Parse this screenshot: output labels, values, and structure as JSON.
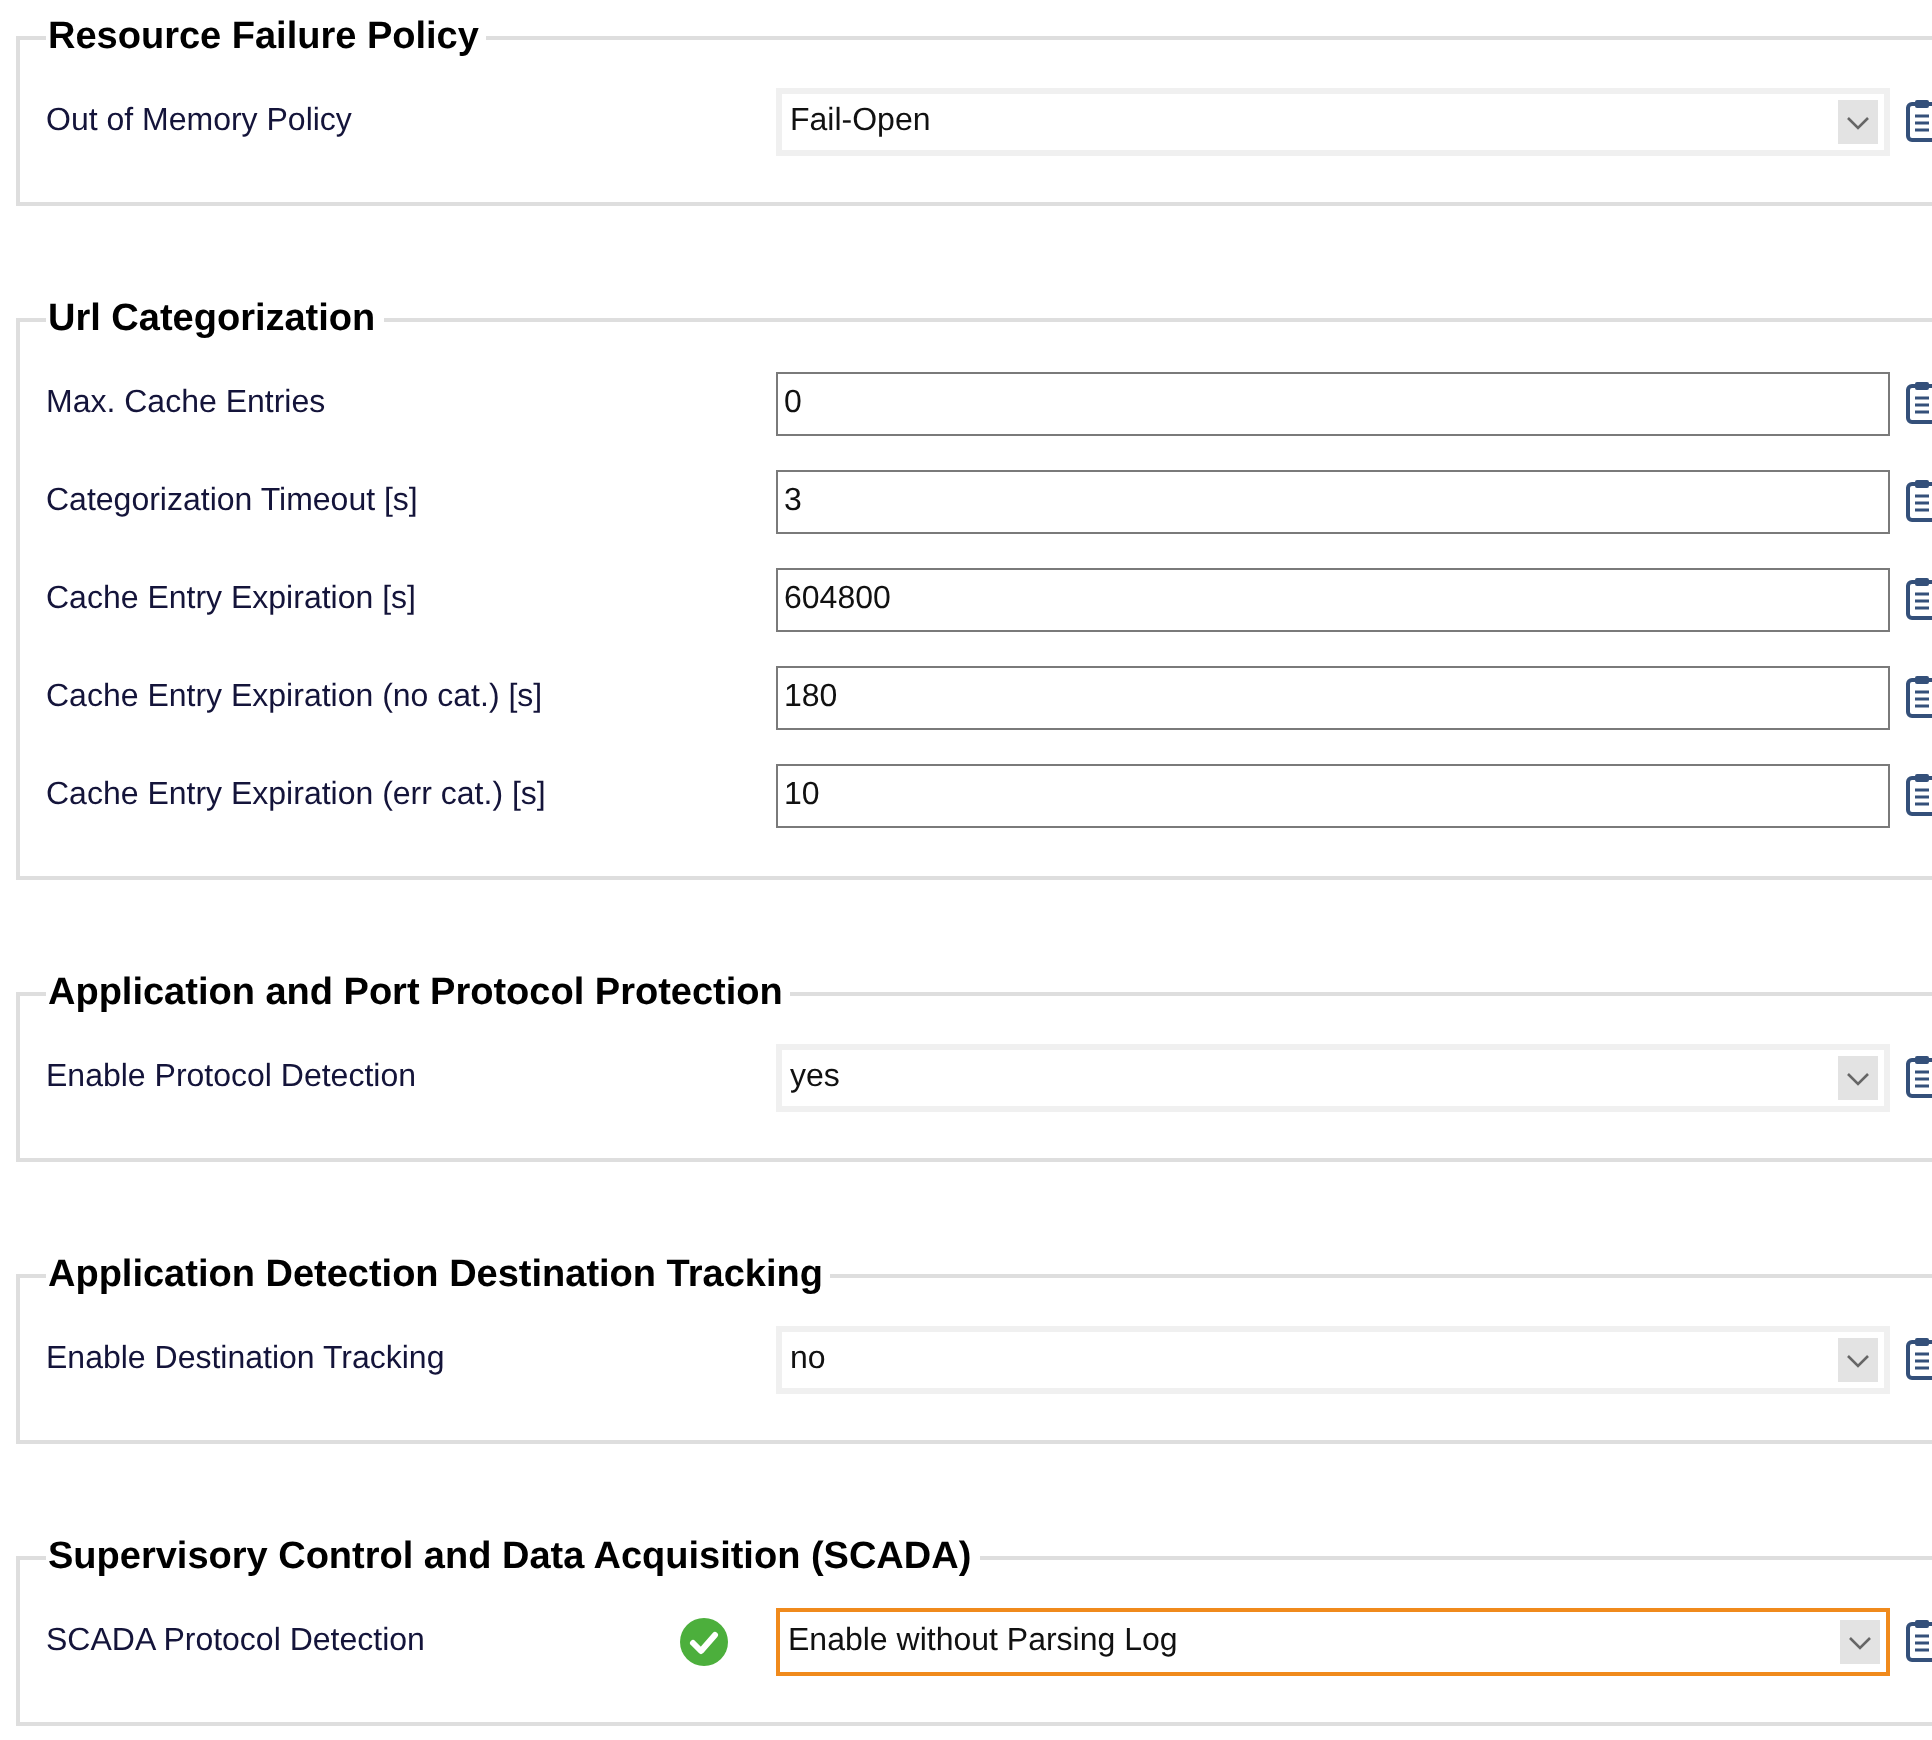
{
  "groups": [
    {
      "title": "Resource Failure Policy",
      "rows": [
        {
          "label": "Out of Memory Policy",
          "kind": "select",
          "value": "Fail-Open",
          "focused": false,
          "validated": false
        }
      ]
    },
    {
      "title": "Url Categorization",
      "rows": [
        {
          "label": "Max. Cache Entries",
          "kind": "text",
          "value": "0"
        },
        {
          "label": "Categorization Timeout [s]",
          "kind": "text",
          "value": "3"
        },
        {
          "label": "Cache Entry Expiration [s]",
          "kind": "text",
          "value": "604800"
        },
        {
          "label": "Cache Entry Expiration (no cat.) [s]",
          "kind": "text",
          "value": "180"
        },
        {
          "label": "Cache Entry Expiration (err cat.) [s]",
          "kind": "text",
          "value": "10"
        }
      ]
    },
    {
      "title": "Application and Port Protocol Protection",
      "rows": [
        {
          "label": "Enable Protocol Detection",
          "kind": "select",
          "value": "yes",
          "focused": false,
          "validated": false
        }
      ]
    },
    {
      "title": "Application Detection Destination Tracking",
      "rows": [
        {
          "label": "Enable Destination Tracking",
          "kind": "select",
          "value": "no",
          "focused": false,
          "validated": false
        }
      ]
    },
    {
      "title": "Supervisory Control and Data Acquisition (SCADA)",
      "rows": [
        {
          "label": "SCADA Protocol Detection",
          "kind": "select",
          "value": "Enable without Parsing Log",
          "focused": true,
          "validated": true
        }
      ]
    }
  ]
}
